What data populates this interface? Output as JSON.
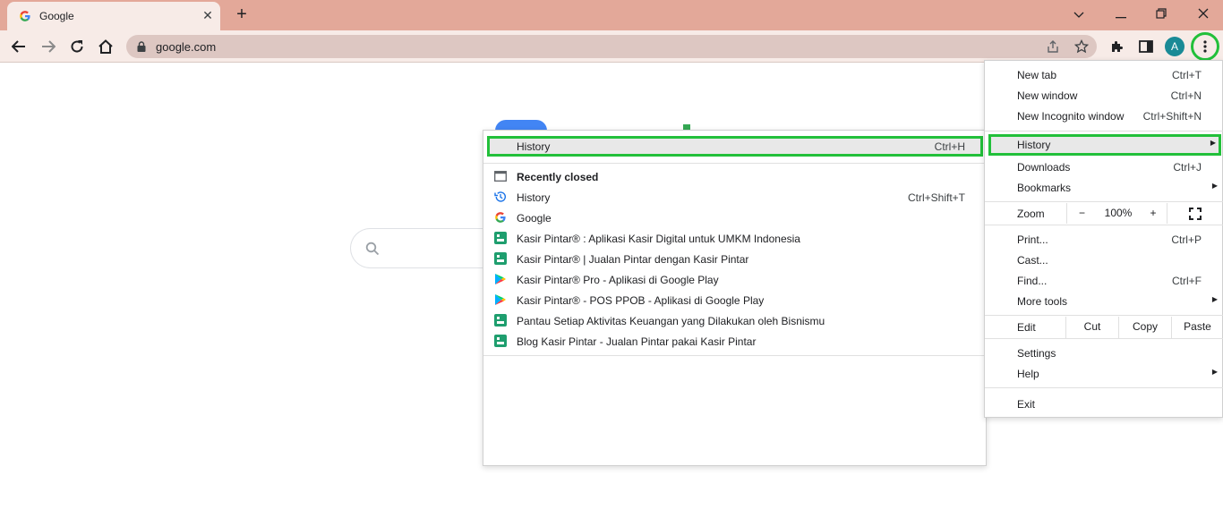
{
  "tab": {
    "title": "Google",
    "close": "✕"
  },
  "new_tab_symbol": "+",
  "window_controls": {
    "dropdown": "⌄",
    "minimize": "—",
    "restore": "❐",
    "close": "✕"
  },
  "omnibox": {
    "url": "google.com"
  },
  "profile": {
    "initial": "A"
  },
  "history_submenu": {
    "history": {
      "label": "History",
      "shortcut": "Ctrl+H"
    },
    "recently_closed": "Recently closed",
    "items": [
      {
        "label": "History",
        "shortcut": "Ctrl+Shift+T",
        "icon": "history-icon"
      },
      {
        "label": "Google",
        "shortcut": "",
        "icon": "google-favicon"
      },
      {
        "label": "Kasir Pintar® : Aplikasi Kasir Digital untuk UMKM Indonesia",
        "shortcut": "",
        "icon": "kasir-pintar-favicon"
      },
      {
        "label": "Kasir Pintar® | Jualan Pintar dengan Kasir Pintar",
        "shortcut": "",
        "icon": "kasir-pintar-favicon"
      },
      {
        "label": "Kasir Pintar® Pro - Aplikasi di Google Play",
        "shortcut": "",
        "icon": "google-play-favicon"
      },
      {
        "label": "Kasir Pintar® - POS  PPOB - Aplikasi di Google Play",
        "shortcut": "",
        "icon": "google-play-favicon"
      },
      {
        "label": "Pantau Setiap Aktivitas Keuangan yang Dilakukan oleh Bisnismu",
        "shortcut": "",
        "icon": "kasir-pintar-favicon"
      },
      {
        "label": "Blog Kasir Pintar - Jualan Pintar pakai Kasir Pintar",
        "shortcut": "",
        "icon": "kasir-pintar-favicon"
      }
    ]
  },
  "main_menu": {
    "new_tab": {
      "label": "New tab",
      "shortcut": "Ctrl+T"
    },
    "new_window": {
      "label": "New window",
      "shortcut": "Ctrl+N"
    },
    "new_incognito": {
      "label": "New Incognito window",
      "shortcut": "Ctrl+Shift+N"
    },
    "history": {
      "label": "History"
    },
    "downloads": {
      "label": "Downloads",
      "shortcut": "Ctrl+J"
    },
    "bookmarks": {
      "label": "Bookmarks"
    },
    "zoom": {
      "label": "Zoom",
      "minus": "−",
      "value": "100%",
      "plus": "+"
    },
    "print": {
      "label": "Print...",
      "shortcut": "Ctrl+P"
    },
    "cast": {
      "label": "Cast..."
    },
    "find": {
      "label": "Find...",
      "shortcut": "Ctrl+F"
    },
    "more_tools": {
      "label": "More tools"
    },
    "edit": {
      "label": "Edit",
      "cut": "Cut",
      "copy": "Copy",
      "paste": "Paste"
    },
    "settings": {
      "label": "Settings"
    },
    "help": {
      "label": "Help"
    },
    "exit": {
      "label": "Exit"
    }
  },
  "colors": {
    "highlight_border": "#22c03a",
    "titlebar": "#e3a899",
    "toolbar": "#f7ebe7"
  }
}
